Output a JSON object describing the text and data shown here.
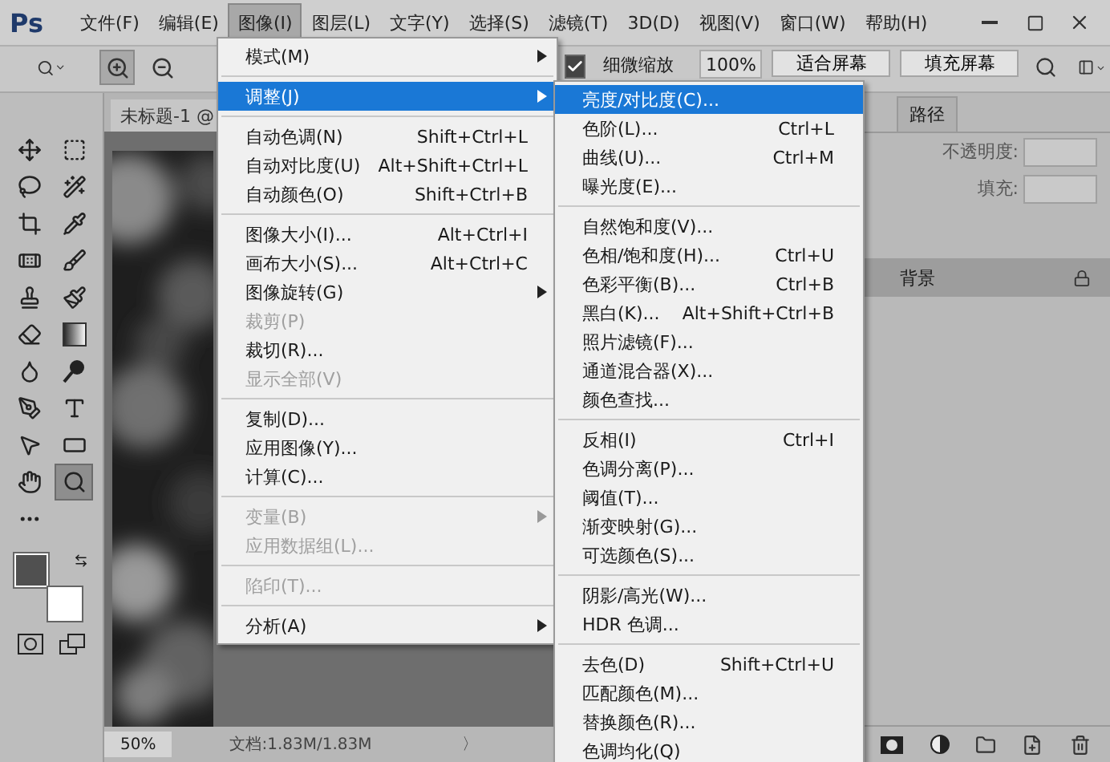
{
  "app": {
    "logo": "Ps"
  },
  "menubar": [
    {
      "label": "文件(F)",
      "selected": false
    },
    {
      "label": "编辑(E)",
      "selected": false
    },
    {
      "label": "图像(I)",
      "selected": true
    },
    {
      "label": "图层(L)",
      "selected": false
    },
    {
      "label": "文字(Y)",
      "selected": false
    },
    {
      "label": "选择(S)",
      "selected": false
    },
    {
      "label": "滤镜(T)",
      "selected": false
    },
    {
      "label": "3D(D)",
      "selected": false
    },
    {
      "label": "视图(V)",
      "selected": false
    },
    {
      "label": "窗口(W)",
      "selected": false
    },
    {
      "label": "帮助(H)",
      "selected": false
    }
  ],
  "options_bar": {
    "tools": [
      {
        "kind": "zoom-in",
        "selected": true
      },
      {
        "kind": "zoom-out",
        "selected": false
      }
    ],
    "fine_zoom": {
      "label": "细微缩放",
      "checked": true
    },
    "zoom_value": "100%",
    "buttons": [
      "适合屏幕",
      "填充屏幕"
    ]
  },
  "tools": [
    {
      "kind": "move",
      "selected": false
    },
    {
      "kind": "marquee",
      "selected": false
    },
    {
      "kind": "lasso",
      "selected": false
    },
    {
      "kind": "wand",
      "selected": false
    },
    {
      "kind": "crop",
      "selected": false
    },
    {
      "kind": "eyedropper",
      "selected": false
    },
    {
      "kind": "healing",
      "selected": false
    },
    {
      "kind": "brush",
      "selected": false
    },
    {
      "kind": "stamp",
      "selected": false
    },
    {
      "kind": "history",
      "selected": false
    },
    {
      "kind": "eraser",
      "selected": false
    },
    {
      "kind": "gradient",
      "selected": false
    },
    {
      "kind": "blur",
      "selected": false
    },
    {
      "kind": "dodge",
      "selected": false
    },
    {
      "kind": "pen",
      "selected": false
    },
    {
      "kind": "type",
      "selected": false
    },
    {
      "kind": "select",
      "selected": false
    },
    {
      "kind": "shape",
      "selected": false
    },
    {
      "kind": "hand",
      "selected": false
    },
    {
      "kind": "zoom",
      "selected": true
    },
    {
      "kind": "more",
      "selected": false
    }
  ],
  "swatches": [
    {
      "color": "#505050"
    },
    {
      "color": "#ffffff"
    }
  ],
  "document": {
    "tab": "未标题-1 @",
    "zoom": "50%",
    "info": "文档:1.83M/1.83M",
    "arrow": "〉"
  },
  "layers_panel": {
    "tabs": [
      {
        "label": "路径"
      }
    ],
    "opacity_label": "不透明度:",
    "fill_label": "填充:",
    "layers": [
      {
        "name": "背景",
        "locked": true
      }
    ]
  },
  "image_menu": {
    "groups": [
      [
        {
          "label": "模式(M)",
          "submenu": true,
          "selected": false,
          "disabled": false
        }
      ],
      [
        {
          "label": "调整(J)",
          "submenu": true,
          "selected": true,
          "disabled": false
        }
      ],
      [
        {
          "label": "自动色调(N)",
          "shortcut": "Shift+Ctrl+L",
          "selected": false,
          "disabled": false
        },
        {
          "label": "自动对比度(U)",
          "shortcut": "Alt+Shift+Ctrl+L",
          "selected": false,
          "disabled": false
        },
        {
          "label": "自动颜色(O)",
          "shortcut": "Shift+Ctrl+B",
          "selected": false,
          "disabled": false
        }
      ],
      [
        {
          "label": "图像大小(I)...",
          "shortcut": "Alt+Ctrl+I",
          "selected": false,
          "disabled": false
        },
        {
          "label": "画布大小(S)...",
          "shortcut": "Alt+Ctrl+C",
          "selected": false,
          "disabled": false
        },
        {
          "label": "图像旋转(G)",
          "submenu": true,
          "selected": false,
          "disabled": false
        },
        {
          "label": "裁剪(P)",
          "selected": false,
          "disabled": true
        },
        {
          "label": "裁切(R)...",
          "selected": false,
          "disabled": false
        },
        {
          "label": "显示全部(V)",
          "selected": false,
          "disabled": true
        }
      ],
      [
        {
          "label": "复制(D)...",
          "selected": false,
          "disabled": false
        },
        {
          "label": "应用图像(Y)...",
          "selected": false,
          "disabled": false
        },
        {
          "label": "计算(C)...",
          "selected": false,
          "disabled": false
        }
      ],
      [
        {
          "label": "变量(B)",
          "submenu": true,
          "selected": false,
          "disabled": true
        },
        {
          "label": "应用数据组(L)...",
          "selected": false,
          "disabled": true
        }
      ],
      [
        {
          "label": "陷印(T)...",
          "selected": false,
          "disabled": true
        }
      ],
      [
        {
          "label": "分析(A)",
          "submenu": true,
          "selected": false,
          "disabled": false
        }
      ]
    ]
  },
  "adjust_menu": {
    "groups": [
      [
        {
          "label": "亮度/对比度(C)...",
          "selected": true
        },
        {
          "label": "色阶(L)...",
          "shortcut": "Ctrl+L",
          "selected": false
        },
        {
          "label": "曲线(U)...",
          "shortcut": "Ctrl+M",
          "selected": false
        },
        {
          "label": "曝光度(E)...",
          "selected": false
        }
      ],
      [
        {
          "label": "自然饱和度(V)...",
          "selected": false
        },
        {
          "label": "色相/饱和度(H)...",
          "shortcut": "Ctrl+U",
          "selected": false
        },
        {
          "label": "色彩平衡(B)...",
          "shortcut": "Ctrl+B",
          "selected": false
        },
        {
          "label": "黑白(K)...",
          "shortcut": "Alt+Shift+Ctrl+B",
          "selected": false
        },
        {
          "label": "照片滤镜(F)...",
          "selected": false
        },
        {
          "label": "通道混合器(X)...",
          "selected": false
        },
        {
          "label": "颜色查找...",
          "selected": false
        }
      ],
      [
        {
          "label": "反相(I)",
          "shortcut": "Ctrl+I",
          "selected": false
        },
        {
          "label": "色调分离(P)...",
          "selected": false
        },
        {
          "label": "阈值(T)...",
          "selected": false
        },
        {
          "label": "渐变映射(G)...",
          "selected": false
        },
        {
          "label": "可选颜色(S)...",
          "selected": false
        }
      ],
      [
        {
          "label": "阴影/高光(W)...",
          "selected": false
        },
        {
          "label": "HDR 色调...",
          "selected": false
        }
      ],
      [
        {
          "label": "去色(D)",
          "shortcut": "Shift+Ctrl+U",
          "selected": false
        },
        {
          "label": "匹配颜色(M)...",
          "selected": false
        },
        {
          "label": "替换颜色(R)...",
          "selected": false
        },
        {
          "label": "色调均化(Q)",
          "selected": false
        }
      ]
    ]
  }
}
